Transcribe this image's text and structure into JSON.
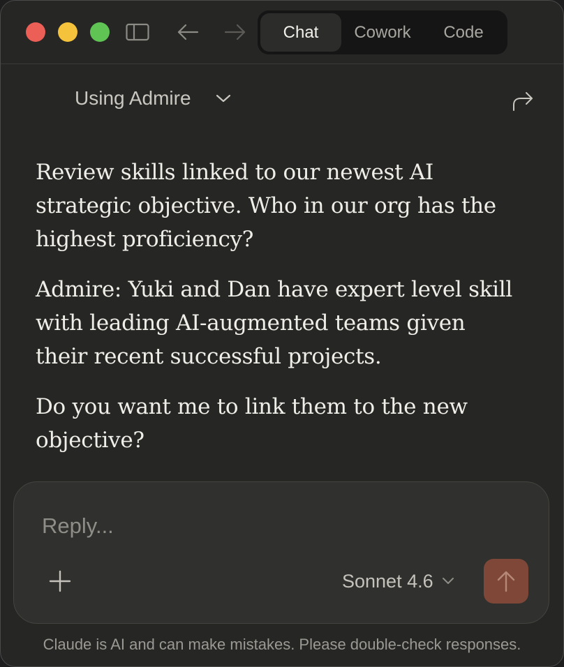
{
  "window": {
    "traffic_lights": [
      "close",
      "minimize",
      "zoom"
    ]
  },
  "toolbar": {
    "sidebar_icon": "sidebar-icon",
    "back_icon": "arrow-left-icon",
    "forward_icon": "arrow-right-icon",
    "tabs": [
      {
        "label": "Chat",
        "active": true
      },
      {
        "label": "Cowork",
        "active": false
      },
      {
        "label": "Code",
        "active": false
      }
    ]
  },
  "header": {
    "context_label": "Using Admire",
    "share_icon": "share-arrow-icon"
  },
  "messages": [
    {
      "text": "Review skills linked to our newest AI strategic objective. Who in our org has the highest proficiency?"
    },
    {
      "text": "Admire: Yuki and Dan have expert level skill with leading AI-augmented teams given their recent successful projects."
    },
    {
      "text": "Do you want me to link them to the new objective?"
    }
  ],
  "composer": {
    "placeholder": "Reply...",
    "model": "Sonnet 4.6",
    "send_button_color": "#7f4737"
  },
  "footer": {
    "disclaimer": "Claude is AI and can make mistakes. Please double-check responses."
  },
  "colors": {
    "background": "#262625",
    "accent": "#7f4737",
    "text": "#f0eee8"
  }
}
